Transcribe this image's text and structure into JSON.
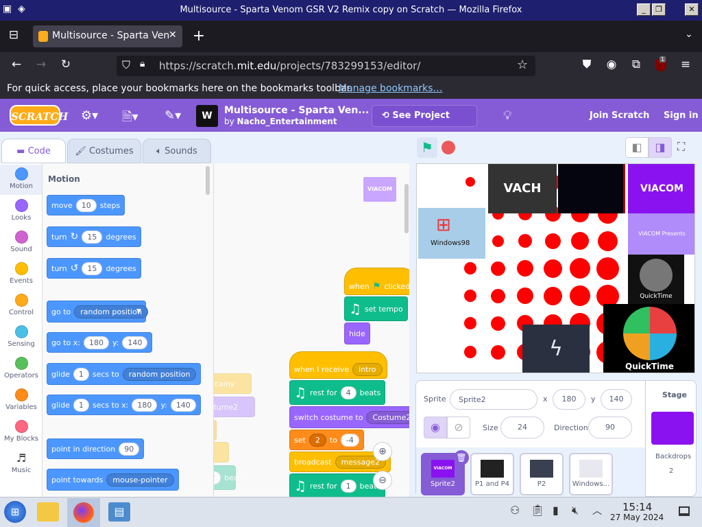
{
  "window": {
    "title": "Multisource - Sparta Venom GSR V2 Remix copy on Scratch — Mozilla Firefox"
  },
  "browser": {
    "tab_title": "Multisource - Sparta Ven",
    "url_prefix": "https://scratch.",
    "url_domain": "mit.edu",
    "url_path": "/projects/783299153/editor/",
    "bookmarks_text": "For quick access, place your bookmarks here on the bookmarks toolbar.",
    "bookmarks_link": "Manage bookmarks…",
    "extension_badge": "1"
  },
  "scratch": {
    "logo": "SCRATCH",
    "project_title": "Multisource - Sparta Ven...",
    "by_label": "by",
    "author": "Nacho_Entertainment",
    "see_project_page": "See Project Page",
    "join": "Join Scratch",
    "signin": "Sign in"
  },
  "editor_tabs": {
    "code": "Code",
    "costumes": "Costumes",
    "sounds": "Sounds"
  },
  "categories": [
    {
      "label": "Motion",
      "color": "#4c97ff"
    },
    {
      "label": "Looks",
      "color": "#9966ff"
    },
    {
      "label": "Sound",
      "color": "#cf63cf"
    },
    {
      "label": "Events",
      "color": "#ffbf00"
    },
    {
      "label": "Control",
      "color": "#ffab19"
    },
    {
      "label": "Sensing",
      "color": "#4cbfe6"
    },
    {
      "label": "Operators",
      "color": "#59c059"
    },
    {
      "label": "Variables",
      "color": "#ff8c1a"
    },
    {
      "label": "My Blocks",
      "color": "#ff6680"
    },
    {
      "label": "Music",
      "icon": "music-note-icon"
    }
  ],
  "palette": {
    "heading": "Motion",
    "move": "move",
    "move_val": "10",
    "steps": "steps",
    "turn": "turn",
    "turn_val": "15",
    "degrees": "degrees",
    "goto": "go to",
    "random_position": "random position",
    "gotoxy": "go to x:",
    "x_val": "180",
    "y_label": "y:",
    "y_val": "140",
    "glide": "glide",
    "glide_secs": "1",
    "secs_to": "secs to",
    "secs_to_x": "secs to x:",
    "point_direction": "point in direction",
    "dir_val": "90",
    "point_towards": "point towards",
    "mouse_pointer": "mouse-pointer"
  },
  "workspace": {
    "when_flag": "when",
    "clicked": "clicked",
    "set_tempo": "set tempo",
    "hide": "hide",
    "when_receive": "when I receive",
    "intro": "intro",
    "rest_for": "rest for",
    "rest_val1": "4",
    "beats": "beats",
    "switch_costume": "switch costume to",
    "costume2": "Costume2",
    "set": "set",
    "set_var": "2",
    "to": "to",
    "set_val": "-4",
    "broadcast": "broadcast",
    "message2": "message2",
    "rest_val2": "1",
    "faded_text1": "uncainy",
    "faded_text2": "ostume2",
    "faded_num1": "2",
    "faded_beats": "beats",
    "thumb_text": "VIACOM"
  },
  "stage_images": {
    "viacom": "VIACOM",
    "viacom2": "VIACOM Presents",
    "windows": "Windows98",
    "quicktime": "QuickTime",
    "quicktime2": "QuickTime"
  },
  "sprite_info": {
    "sprite_label": "Sprite",
    "sprite_name": "Sprite2",
    "x_label": "x",
    "x_val": "180",
    "y_label": "y",
    "y_val": "140",
    "size_label": "Size",
    "size_val": "24",
    "direction_label": "Direction",
    "direction_val": "90",
    "stage_label": "Stage",
    "backdrops_label": "Backdrops",
    "backdrops_count": "2",
    "sprites": [
      {
        "name": "Sprite2",
        "thumb_text": "VIACOM"
      },
      {
        "name": "P1 and P4"
      },
      {
        "name": "P2"
      },
      {
        "name": "Windows..."
      }
    ]
  },
  "taskbar": {
    "time": "15:14",
    "date": "27 May 2024"
  }
}
